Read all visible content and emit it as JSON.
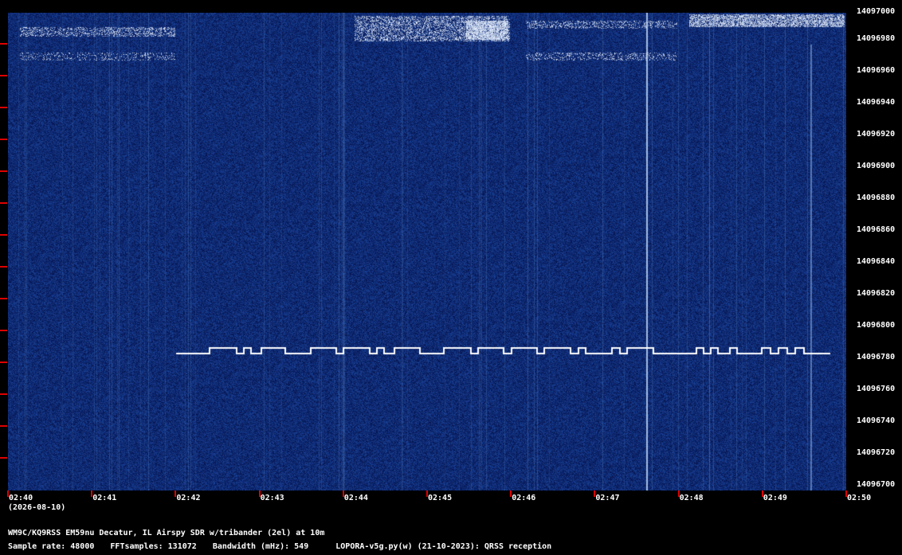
{
  "frequency_labels": [
    "14097000",
    "14096980",
    "14096960",
    "14096940",
    "14096920",
    "14096900",
    "14096880",
    "14096860",
    "14096840",
    "14096820",
    "14096800",
    "14096780",
    "14096760",
    "14096740",
    "14096720",
    "14096700"
  ],
  "time_labels": [
    "02:40",
    "02:41",
    "02:42",
    "02:43",
    "02:44",
    "02:45",
    "02:46",
    "02:47",
    "02:48",
    "02:49",
    "02:50"
  ],
  "date_label": "(2026-08-10)",
  "station_line": "WM9C/KQ9RSS EM59nu Decatur, IL  Airspy SDR w/tribander (2el) at 10m",
  "params": {
    "sample_rate": "Sample rate: 48000",
    "fft_samples": "FFTsamples: 131072",
    "bandwidth": "Bandwidth (mHz): 549",
    "software": "LOPORA-v5g.py(w) (21-10-2023): QRSS reception"
  },
  "colors": {
    "background": "#0a1f55",
    "signal": "#ffffff",
    "tick": "#dd0000"
  },
  "chart_data": {
    "type": "heatmap",
    "x_range": [
      "02:40",
      "02:50"
    ],
    "y_range": [
      14096700,
      14097000
    ],
    "signals": [
      {
        "kind": "fsk-cw",
        "start": "02:42",
        "end": "02:50",
        "frequency": 14096782,
        "shift": 4
      }
    ]
  }
}
